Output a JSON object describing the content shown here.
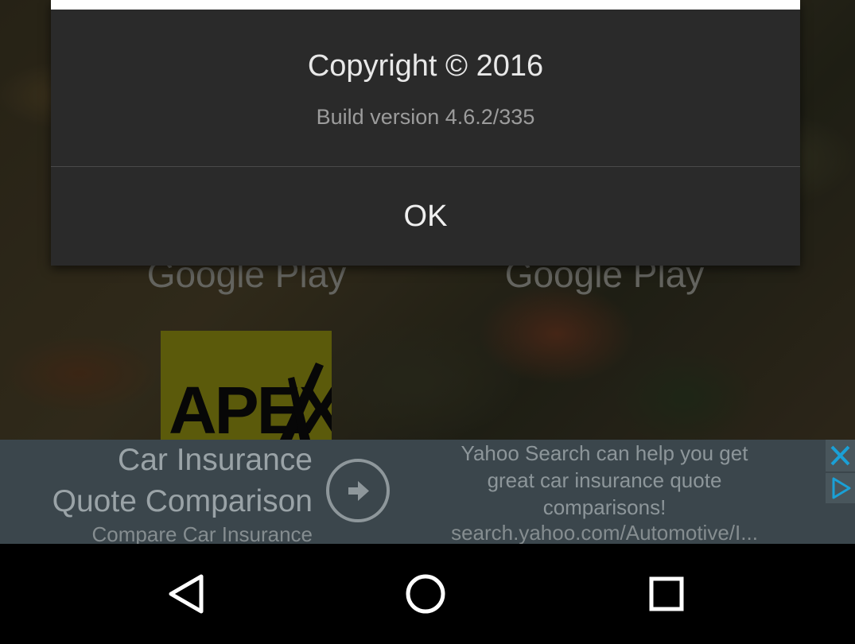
{
  "background": {
    "store_badge_left": "Google Play",
    "store_badge_right": "Google Play",
    "apex_logo_text": "APEX"
  },
  "dialog": {
    "copyright": "Copyright © 2016",
    "build_version": "Build version 4.6.2/335",
    "ok_label": "OK"
  },
  "ad": {
    "headline_line1": "Car Insurance",
    "headline_line2": "Quote Comparison",
    "subheadline": "Compare Car Insurance",
    "body_line1": "Yahoo Search can help you get",
    "body_line2": "great car insurance quote",
    "body_line3": "comparisons!",
    "url": "search.yahoo.com/Automotive/I...",
    "icons": [
      "arrow-right-icon",
      "close-icon",
      "adchoices-icon"
    ]
  },
  "navbar": {
    "icons": [
      "back-icon",
      "home-icon",
      "recents-icon"
    ]
  },
  "colors": {
    "dialog_bg": "#2a2a2a",
    "ad_bg": "#3b464c",
    "ad_icon_accent": "#1aa0d6"
  }
}
